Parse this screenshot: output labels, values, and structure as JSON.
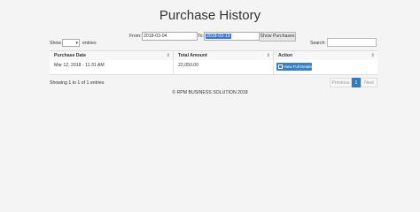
{
  "page": {
    "title": "Purchase History"
  },
  "filter": {
    "from_label": "From:",
    "from_value": "2018-03-04",
    "to_label": "To:",
    "to_value": "2018-03-13",
    "show_button": "Show Purchases"
  },
  "table_controls": {
    "show_label": "Show",
    "entries_label": "entries",
    "search_label": "Search:"
  },
  "table": {
    "columns": [
      "Purchase Date",
      "Total Amount",
      "Action"
    ],
    "sort_glyph": "⇕",
    "rows": [
      {
        "date": "Mar 12, 2018 - 11:31 AM",
        "amount": "22,050.00",
        "action": "View Full Details"
      }
    ]
  },
  "info": "Showing 1 to 1 of 1 entries",
  "pagination": {
    "previous": "Previous",
    "page": "1",
    "next": "Next"
  },
  "footer": "© RPM BUSINESS SOLUTION 2018",
  "colors": {
    "primary": "#337ab7",
    "selection": "#3a77c9"
  }
}
